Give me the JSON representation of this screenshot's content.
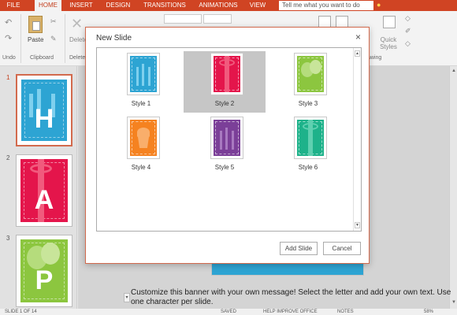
{
  "ribbon_tabs": [
    "FILE",
    "HOME",
    "INSERT",
    "DESIGN",
    "TRANSITIONS",
    "ANIMATIONS",
    "VIEW"
  ],
  "tell_me": "Tell me what you want to do",
  "ribbon": {
    "undo_label": "Undo",
    "clipboard_label": "Clipboard",
    "paste_label": "Paste",
    "delete_label": "Delete",
    "delete_group": "Delete",
    "quick_styles": "Quick Styles",
    "drawing_label": "awing"
  },
  "thumbnails": [
    {
      "number": "1",
      "letter": "H",
      "color": "#2da4d3",
      "selected": true
    },
    {
      "number": "2",
      "letter": "A",
      "color": "#e4154b",
      "selected": false
    },
    {
      "number": "3",
      "letter": "P",
      "color": "#8cc63f",
      "selected": false
    }
  ],
  "notes": "Customize this banner with your own message! Select the letter and add your own text. Use one character per slide.",
  "status": {
    "slide": "SLIDE 1 OF 14",
    "saved": "SAVED",
    "help": "HELP IMPROVE OFFICE",
    "notes": "NOTES",
    "zoom": "58%"
  },
  "dialog": {
    "title": "New Slide",
    "close": "×",
    "styles": [
      {
        "label": "Style 1",
        "color": "#2da4d3",
        "motif": "candles",
        "selected": false
      },
      {
        "label": "Style 2",
        "color": "#e4154b",
        "motif": "bow",
        "selected": true
      },
      {
        "label": "Style 3",
        "color": "#8cc63f",
        "motif": "balloons",
        "selected": false
      },
      {
        "label": "Style 4",
        "color": "#f58220",
        "motif": "cupcake",
        "selected": false
      },
      {
        "label": "Style 5",
        "color": "#7b3f98",
        "motif": "candles",
        "selected": false
      },
      {
        "label": "Style 6",
        "color": "#1eb28a",
        "motif": "bow",
        "selected": false
      }
    ],
    "add_button": "Add Slide",
    "cancel_button": "Cancel"
  },
  "colors": {
    "accent": "#c43e1c",
    "tab_bar": "#d04423"
  }
}
